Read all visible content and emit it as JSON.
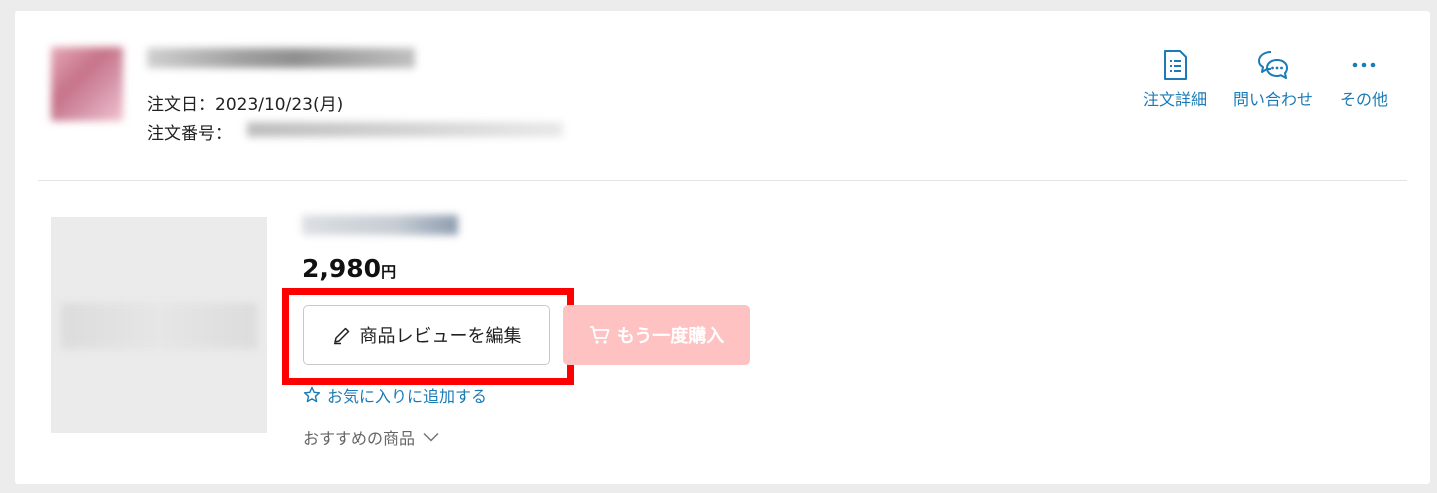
{
  "order": {
    "date_label": "注文日：2023/10/23(月)",
    "number_label": "注文番号："
  },
  "header_actions": [
    {
      "label": "注文詳細",
      "icon": "document-list-icon"
    },
    {
      "label": "問い合わせ",
      "icon": "chat-bubbles-icon"
    },
    {
      "label": "その他",
      "icon": "more-dots-icon"
    }
  ],
  "product": {
    "price": "2,980",
    "price_unit": "円"
  },
  "buttons": {
    "review_edit": "商品レビューを編集",
    "rebuy": "もう一度購入"
  },
  "links": {
    "add_favorite": "お気に入りに追加する",
    "recommended": "おすすめの商品"
  },
  "colors": {
    "link_blue": "#1a7bb6",
    "rebuy_disabled": "#ffc2c2",
    "highlight_red": "#ff0000"
  }
}
